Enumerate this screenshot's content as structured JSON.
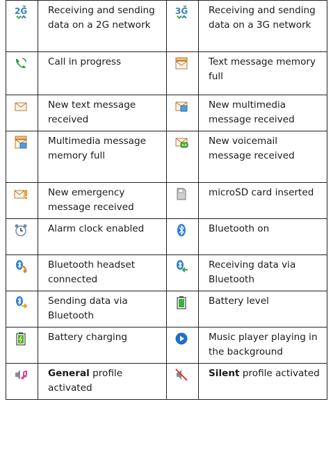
{
  "rows": [
    {
      "left": {
        "icon": "2g-data-icon",
        "text": "Receiving and sending data on a 2G network"
      },
      "right": {
        "icon": "3g-data-icon",
        "text": "Receiving and sending data on a 3G network"
      }
    },
    {
      "left": {
        "icon": "call-in-progress-icon",
        "text": "Call in progress"
      },
      "right": {
        "icon": "text-memory-full-icon",
        "text": "Text message memory full"
      }
    },
    {
      "left": {
        "icon": "new-text-message-icon",
        "text": "New text message received"
      },
      "right": {
        "icon": "new-multimedia-message-icon",
        "text": "New multimedia message received"
      }
    },
    {
      "left": {
        "icon": "multimedia-memory-full-icon",
        "text": "Multimedia message memory full"
      },
      "right": {
        "icon": "new-voicemail-icon",
        "text": "New voicemail message received"
      }
    },
    {
      "left": {
        "icon": "emergency-message-icon",
        "text": "New emergency message received"
      },
      "right": {
        "icon": "microsd-card-icon",
        "text": "microSD card inserted"
      }
    },
    {
      "left": {
        "icon": "alarm-clock-icon",
        "text": "Alarm clock enabled"
      },
      "right": {
        "icon": "bluetooth-icon",
        "text": "Bluetooth on"
      }
    },
    {
      "left": {
        "icon": "bluetooth-headset-icon",
        "text": "Bluetooth headset connected"
      },
      "right": {
        "icon": "bluetooth-receive-icon",
        "text": "Receiving data via Bluetooth"
      }
    },
    {
      "left": {
        "icon": "bluetooth-send-icon",
        "text": "Sending data via Bluetooth"
      },
      "right": {
        "icon": "battery-level-icon",
        "text": "Battery level"
      }
    },
    {
      "left": {
        "icon": "battery-charging-icon",
        "text": "Battery charging"
      },
      "right": {
        "icon": "music-playing-icon",
        "text": "Music player playing in the background"
      }
    },
    {
      "left": {
        "icon": "general-profile-icon",
        "bold": "General",
        "text": " profile activated"
      },
      "right": {
        "icon": "silent-profile-icon",
        "bold": "Silent",
        "text": " profile activated"
      }
    }
  ]
}
